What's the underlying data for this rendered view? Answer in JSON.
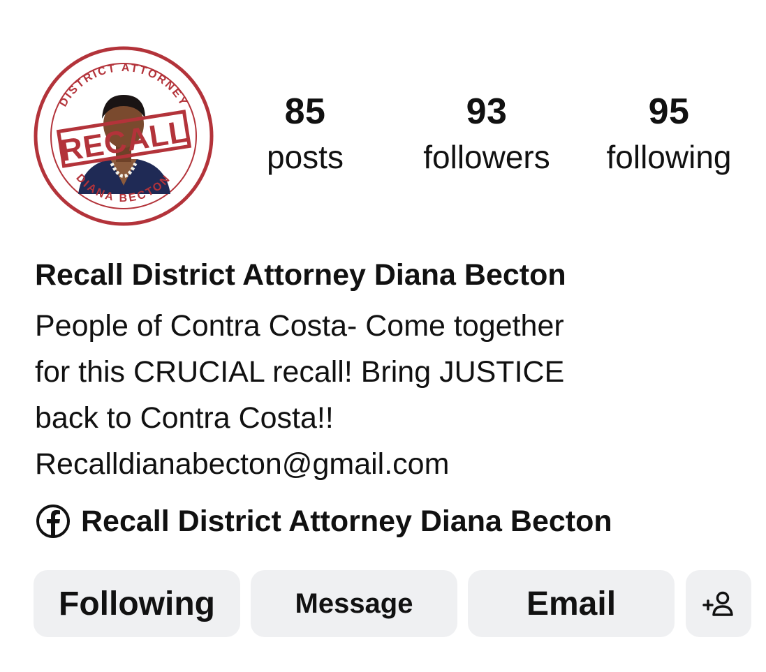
{
  "avatar": {
    "icon": "recall-district-attorney-diana-becton-logo",
    "top_text": "DISTRICT ATTORNEY",
    "stamp_text": "RECALL",
    "bottom_text": "DIANA BECTON",
    "color": "#b3333a"
  },
  "stats": {
    "posts": {
      "count": "85",
      "label": "posts"
    },
    "followers": {
      "count": "93",
      "label": "followers"
    },
    "following": {
      "count": "95",
      "label": "following"
    }
  },
  "profile": {
    "name": "Recall District Attorney Diana Becton",
    "bio": "People of Contra Costa- Come together\nfor this CRUCIAL recall! Bring JUSTICE\nback to Contra Costa!!\nRecalldianabecton@gmail.com",
    "link": {
      "icon": "facebook-icon",
      "text": "Recall District Attorney Diana Becton"
    }
  },
  "actions": {
    "following_label": "Following",
    "message_label": "Message",
    "email_label": "Email",
    "suggest_icon": "add-person-icon"
  },
  "colors": {
    "button_bg": "#eff0f2",
    "text": "#111111",
    "logo_red": "#b3333a"
  }
}
